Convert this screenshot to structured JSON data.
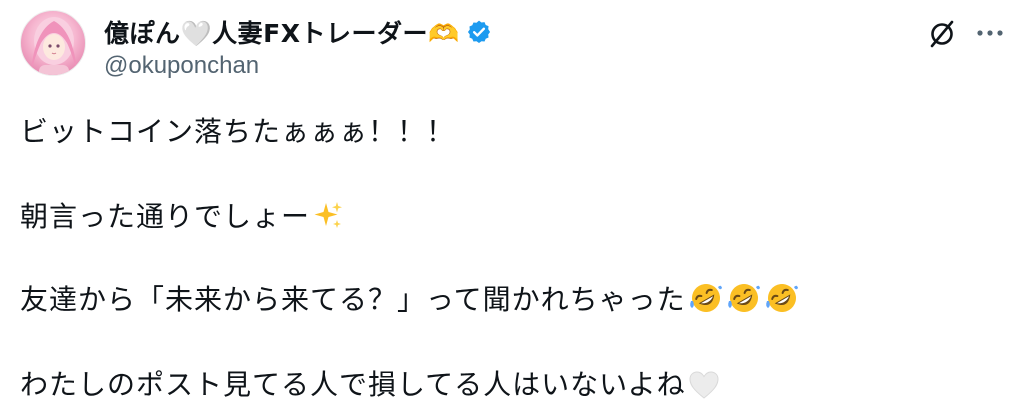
{
  "author": {
    "display_name": "億ぽん🤍人妻FXトレーダー🫶",
    "handle": "@okuponchan",
    "verified": true
  },
  "header_icons": {
    "verified": "verified-badge-icon",
    "grok": "grok-icon",
    "more": "more-options-icon"
  },
  "tweet": {
    "line1": "ビットコイン落ちたぁぁぁ！！！",
    "line2": "朝言った通りでしょー",
    "line3": "友達から「未来から来てる？」って聞かれちゃった",
    "line4": "わたしのポスト見てる人で損してる人はいないよね"
  },
  "emojis": {
    "sparkles": "sparkles-emoji",
    "rofl": "rolling-on-floor-laughing-emoji",
    "white_heart": "white-heart-emoji"
  },
  "colors": {
    "text": "#0f1419",
    "handle": "#536471",
    "verified": "#1d9bf0"
  }
}
